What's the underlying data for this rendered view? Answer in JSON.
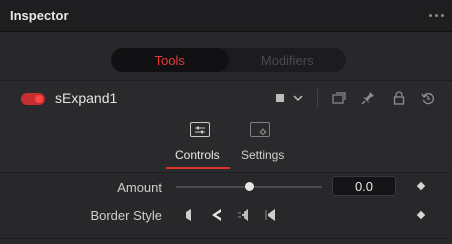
{
  "header": {
    "title": "Inspector"
  },
  "tabs": [
    {
      "label": "Tools",
      "active": true
    },
    {
      "label": "Modifiers",
      "active": false
    }
  ],
  "tool": {
    "name": "sExpand1",
    "enabled": true
  },
  "subtabs": [
    {
      "label": "Controls",
      "active": true
    },
    {
      "label": "Settings",
      "active": false
    }
  ],
  "params": {
    "amount": {
      "label": "Amount",
      "value": "0.0",
      "slider_fraction": 0.5
    },
    "border_style": {
      "label": "Border Style"
    }
  },
  "colors": {
    "accent": "#e03131",
    "panel": "#28282b",
    "header": "#1e1e20"
  },
  "icons": [
    "color-swatch-icon",
    "chevron-down-icon",
    "versions-icon",
    "pin-icon",
    "lock-icon",
    "reset-icon",
    "controls-icon",
    "settings-icon",
    "keyframe-diamond-icon",
    "border-style-icon"
  ]
}
